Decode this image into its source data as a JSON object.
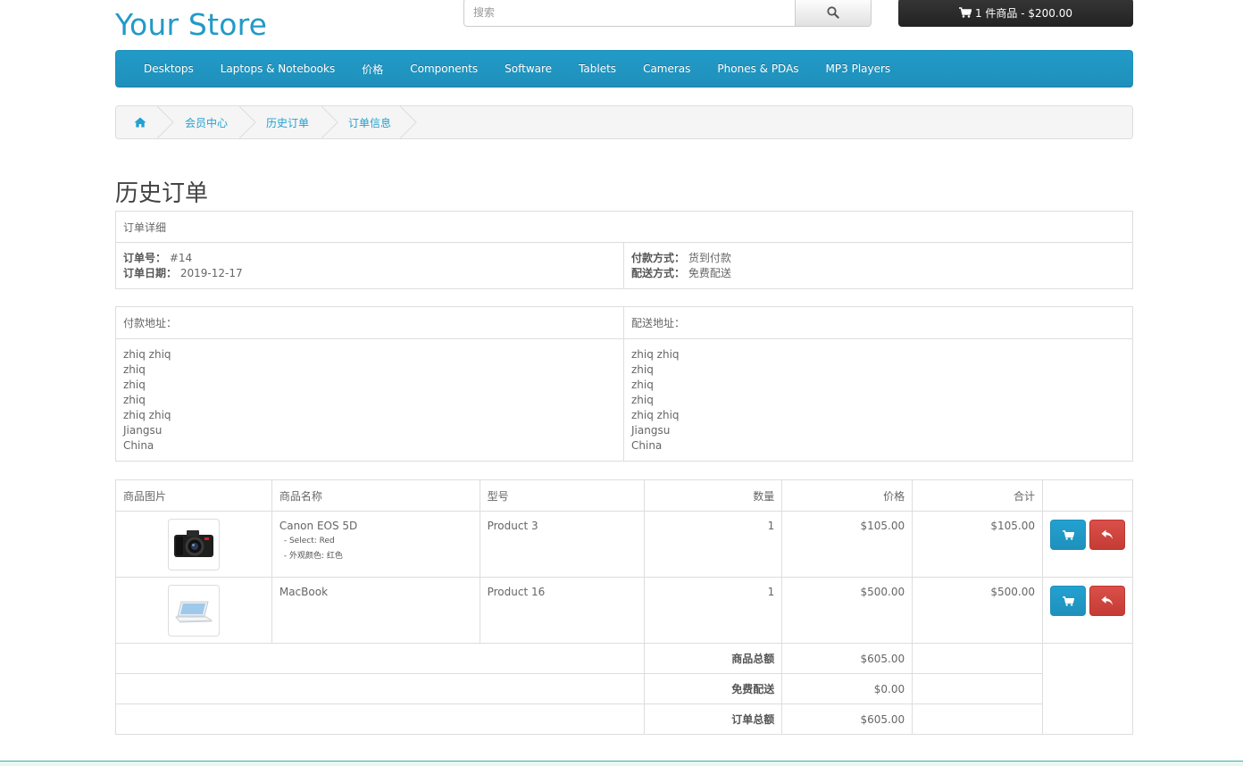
{
  "header": {
    "logo": "Your Store",
    "search_placeholder": "搜索",
    "cart_label": "1 件商品 - $200.00"
  },
  "nav": [
    "Desktops",
    "Laptops & Notebooks",
    "价格",
    "Components",
    "Software",
    "Tablets",
    "Cameras",
    "Phones & PDAs",
    "MP3 Players"
  ],
  "breadcrumb": [
    "会员中心",
    "历史订单",
    "订单信息"
  ],
  "page_title": "历史订单",
  "details": {
    "heading": "订单详细",
    "order_id_label": "订单号：",
    "order_id": "#14",
    "date_label": "订单日期：",
    "date": "2019-12-17",
    "payment_label": "付款方式：",
    "payment": "货到付款",
    "shipping_label": "配送方式：",
    "shipping": "免费配送"
  },
  "address": {
    "payment_heading": "付款地址：",
    "shipping_heading": "配送地址：",
    "payment_lines": [
      "zhiq zhiq",
      "zhiq",
      "zhiq",
      "zhiq",
      "zhiq zhiq",
      "Jiangsu",
      "China"
    ],
    "shipping_lines": [
      "zhiq zhiq",
      "zhiq",
      "zhiq",
      "zhiq",
      "zhiq zhiq",
      "Jiangsu",
      "China"
    ]
  },
  "products": {
    "headers": [
      "商品图片",
      "商品名称",
      "型号",
      "数量",
      "价格",
      "合计"
    ],
    "rows": [
      {
        "name": "Canon EOS 5D",
        "options": [
          "- Select: Red",
          "- 外观颜色: 红色"
        ],
        "model": "Product 3",
        "qty": "1",
        "price": "$105.00",
        "total": "$105.00",
        "image": "camera-image"
      },
      {
        "name": "MacBook",
        "options": [],
        "model": "Product 16",
        "qty": "1",
        "price": "$500.00",
        "total": "$500.00",
        "image": "laptop-image"
      }
    ],
    "totals": [
      {
        "label": "商品总额",
        "value": "$605.00"
      },
      {
        "label": "免费配送",
        "value": "$0.00"
      },
      {
        "label": "订单总额",
        "value": "$605.00"
      }
    ]
  },
  "colors": {
    "accent": "#229ac8",
    "link": "#23a1d1",
    "danger": "#da4f49"
  }
}
